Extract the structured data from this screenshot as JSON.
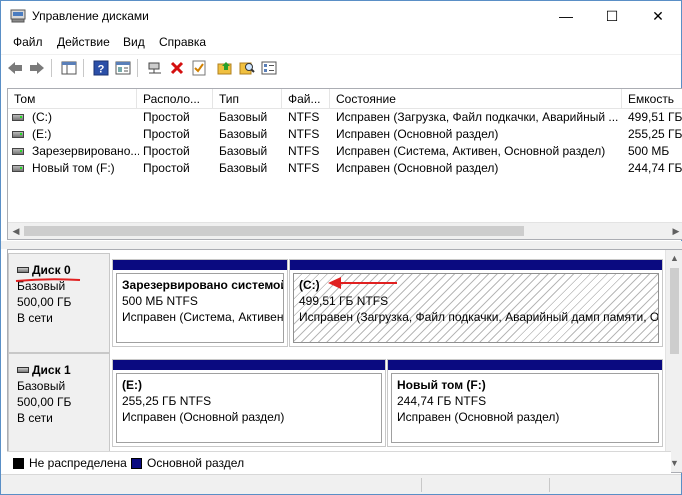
{
  "window": {
    "title": "Управление дисками",
    "minimize": "—",
    "maximize": "☐",
    "close": "✕"
  },
  "menu": [
    "Файл",
    "Действие",
    "Вид",
    "Справка"
  ],
  "toolbar_icons": [
    "back-icon",
    "forward-icon",
    "console-tree-icon",
    "help-icon",
    "properties-icon",
    "connect-icon",
    "delete-icon",
    "check-icon",
    "folder-up-icon",
    "search-icon",
    "list-icon"
  ],
  "volumes": {
    "columns": [
      "Том",
      "Располо...",
      "Тип",
      "Фай...",
      "Состояние",
      "Емкость"
    ],
    "rows": [
      [
        "(C:)",
        "Простой",
        "Базовый",
        "NTFS",
        "Исправен (Загрузка, Файл подкачки, Аварийный ...",
        "499,51 ГБ"
      ],
      [
        "(E:)",
        "Простой",
        "Базовый",
        "NTFS",
        "Исправен (Основной раздел)",
        "255,25 ГБ"
      ],
      [
        "Зарезервировано...",
        "Простой",
        "Базовый",
        "NTFS",
        "Исправен (Система, Активен, Основной раздел)",
        "500 МБ"
      ],
      [
        "Новый том (F:)",
        "Простой",
        "Базовый",
        "NTFS",
        "Исправен (Основной раздел)",
        "244,74 ГБ"
      ]
    ]
  },
  "disks": [
    {
      "name": "Диск 0",
      "type": "Базовый",
      "size": "500,00 ГБ",
      "status": "В сети",
      "partitions": [
        {
          "name": "Зарезервировано системой",
          "size": "500 МБ NTFS",
          "state": "Исправен (Система, Активен, Основной раздел)"
        },
        {
          "name": "(C:)",
          "size": "499,51 ГБ NTFS",
          "state": "Исправен (Загрузка, Файл подкачки, Аварийный дамп памяти, Основной раздел)"
        }
      ]
    },
    {
      "name": "Диск 1",
      "type": "Базовый",
      "size": "500,00 ГБ",
      "status": "В сети",
      "partitions": [
        {
          "name": "(E:)",
          "size": "255,25 ГБ NTFS",
          "state": "Исправен (Основной раздел)"
        },
        {
          "name": "Новый том  (F:)",
          "size": "244,74 ГБ NTFS",
          "state": "Исправен (Основной раздел)"
        }
      ]
    }
  ],
  "legend": {
    "unallocated": "Не распределена",
    "primary": "Основной раздел",
    "unallocated_color": "#000000",
    "primary_color": "#0a0a80"
  },
  "colors": {
    "partition_bar": "#0a0a80",
    "annotation": "#e02020"
  }
}
